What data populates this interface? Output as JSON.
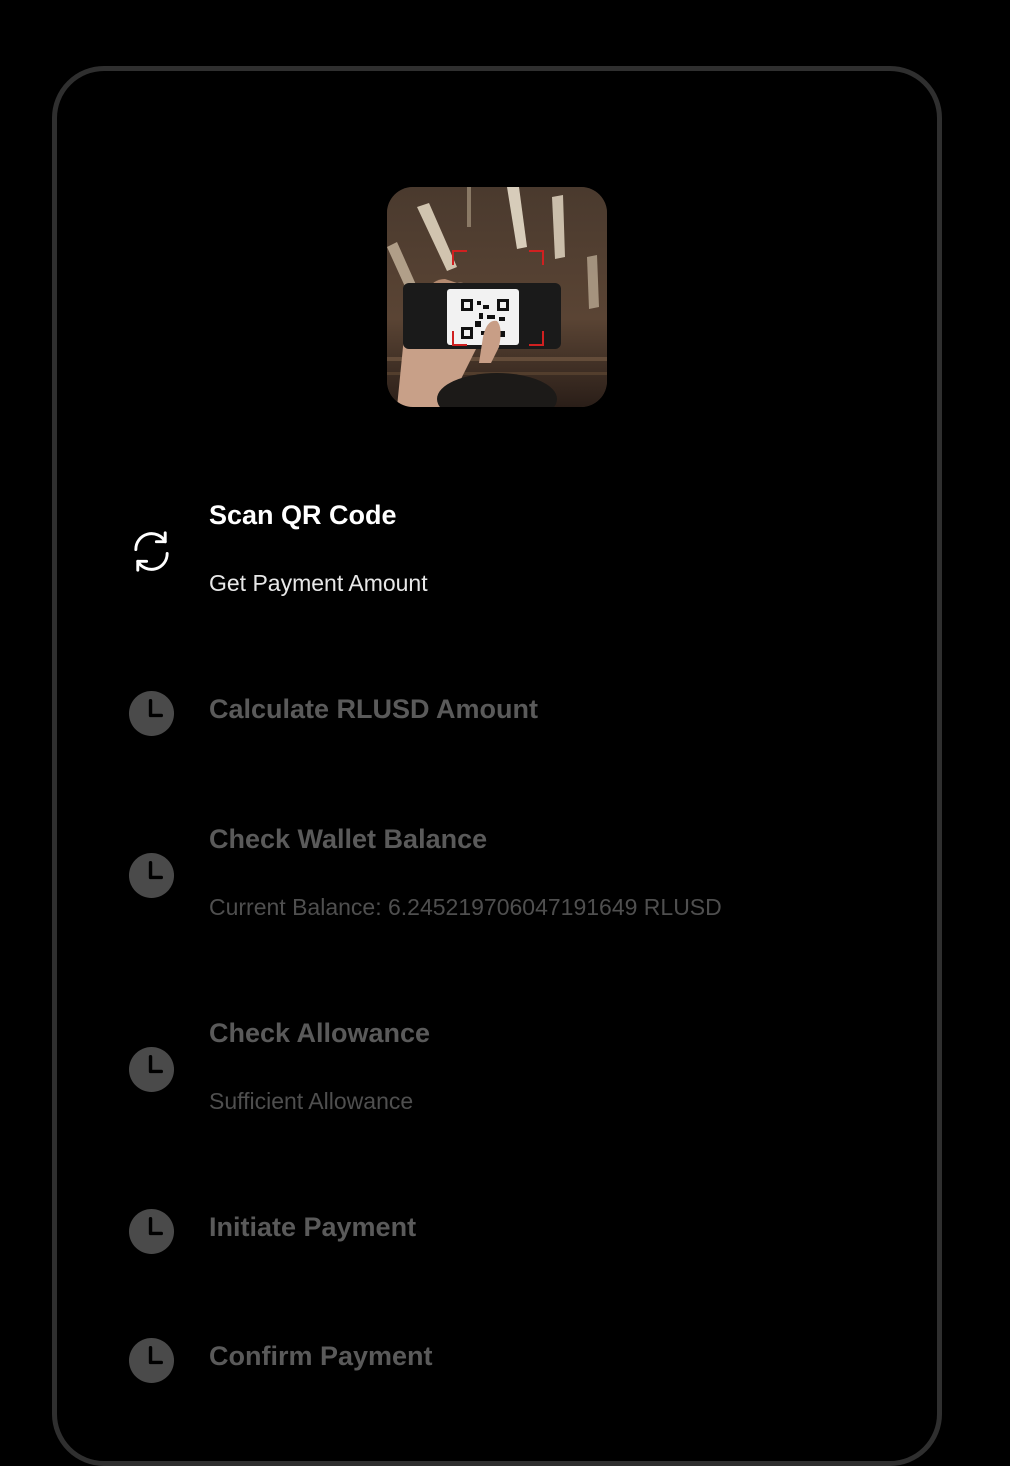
{
  "camera_preview": {
    "icon": "camera-qr-preview"
  },
  "steps": [
    {
      "title": "Scan QR Code",
      "subtitle": "Get Payment Amount",
      "status": "in-progress",
      "icon": "refresh-icon"
    },
    {
      "title": "Calculate RLUSD Amount",
      "subtitle": "",
      "status": "pending",
      "icon": "clock-icon"
    },
    {
      "title": "Check Wallet Balance",
      "subtitle": "Current Balance: 6.245219706047191649 RLUSD",
      "status": "pending",
      "icon": "clock-icon"
    },
    {
      "title": "Check Allowance",
      "subtitle": "Sufficient Allowance",
      "status": "pending",
      "icon": "clock-icon"
    },
    {
      "title": "Initiate Payment",
      "subtitle": "",
      "status": "pending",
      "icon": "clock-icon"
    },
    {
      "title": "Confirm Payment",
      "subtitle": "",
      "status": "pending",
      "icon": "clock-icon"
    }
  ],
  "colors": {
    "background": "#000000",
    "frame_border": "#2f2f2f",
    "active_text": "#ffffff",
    "pending_text": "#5a5a5a",
    "pending_icon": "#4a4a4a"
  }
}
